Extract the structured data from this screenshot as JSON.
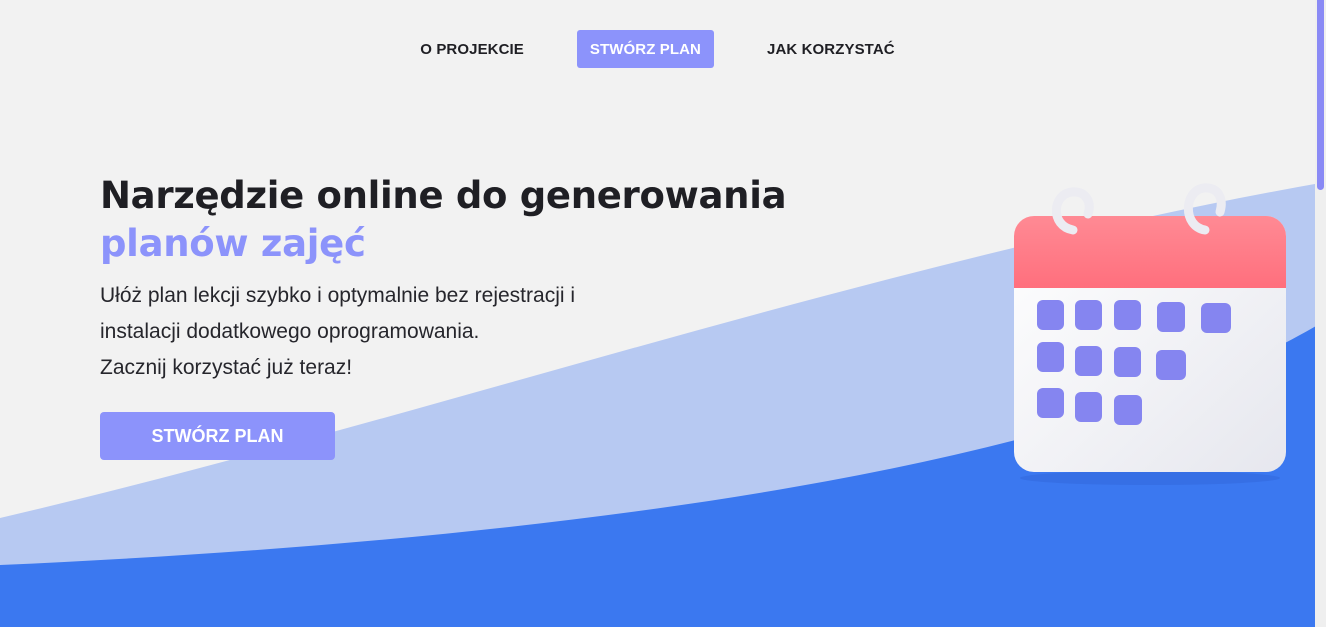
{
  "nav": {
    "items": [
      {
        "label": "O PROJEKCIE",
        "active": false
      },
      {
        "label": "STWÓRZ PLAN",
        "active": true
      },
      {
        "label": "JAK KORZYSTAĆ",
        "active": false
      }
    ]
  },
  "hero": {
    "title_line1": "Narzędzie online do generowania",
    "title_line2": "planów zajęć",
    "description_line1": "Ułóż plan lekcji szybko i optymalnie bez rejestracji i",
    "description_line2": "instalacji dodatkowego oprogramowania.",
    "description_line3": "Zacznij korzystać już teraz!",
    "cta_label": "STWÓRZ PLAN"
  },
  "illustration": {
    "icon": "calendar-icon"
  },
  "colors": {
    "accent": "#8c93fb",
    "background": "#f2f2f2",
    "wave_light": "#b7c9f2",
    "wave_dark": "#3b78f0",
    "calendar_header": "#ff7683",
    "calendar_cell": "#8585f0"
  }
}
